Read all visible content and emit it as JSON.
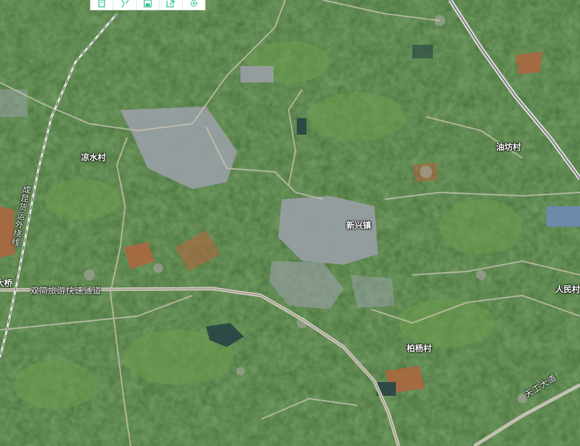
{
  "toolbar": {
    "tools": [
      {
        "name": "layers-tool-icon"
      },
      {
        "name": "fullscreen-tool-icon"
      },
      {
        "name": "save-tool-icon"
      },
      {
        "name": "export-tool-icon"
      },
      {
        "name": "settings-gear-icon"
      }
    ],
    "icon_color": "#2bbf8a"
  },
  "labels": {
    "liangshui_village": "凉水村",
    "youfang_village": "油坊村",
    "xinxing_town": "新兴镇",
    "baiyang_village": "柏杨村",
    "renmin_partial": "人民村",
    "bridge_partial": "大桥",
    "chengdu_ring_rail": "成昆货运外绕线",
    "shuangjian_expressway": "双简旅游快速通道",
    "tiangong_avenue": "天工大道"
  },
  "colors": {
    "vegetation": "#3d6a34",
    "field_light": "#6d9a4c",
    "soil": "#b0653f",
    "road": "#c9c2b2",
    "urban": "#9aa0a6",
    "water": "#2e4a46"
  }
}
